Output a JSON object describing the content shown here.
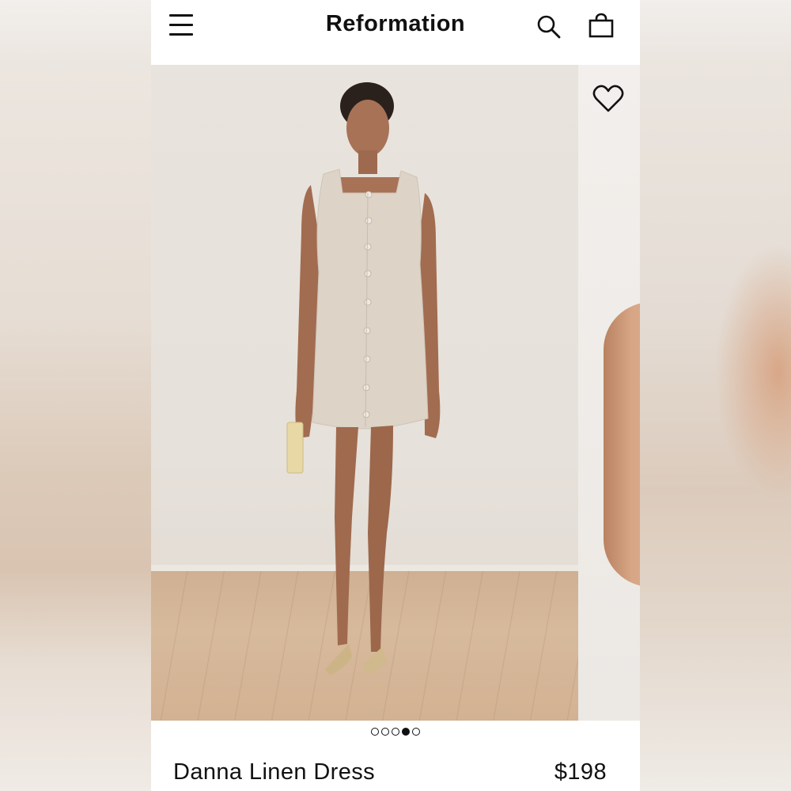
{
  "header": {
    "brand": "Reformation",
    "menu_icon": "hamburger-menu-icon",
    "search_icon": "search-icon",
    "bag_icon": "shopping-bag-icon"
  },
  "gallery": {
    "favorite_icon": "heart-outline-icon",
    "image_count": 5,
    "active_index": 3
  },
  "product": {
    "name": "Danna Linen Dress",
    "price": "$198"
  },
  "colors": {
    "text": "#111111",
    "header_bg": "#ffffff"
  }
}
